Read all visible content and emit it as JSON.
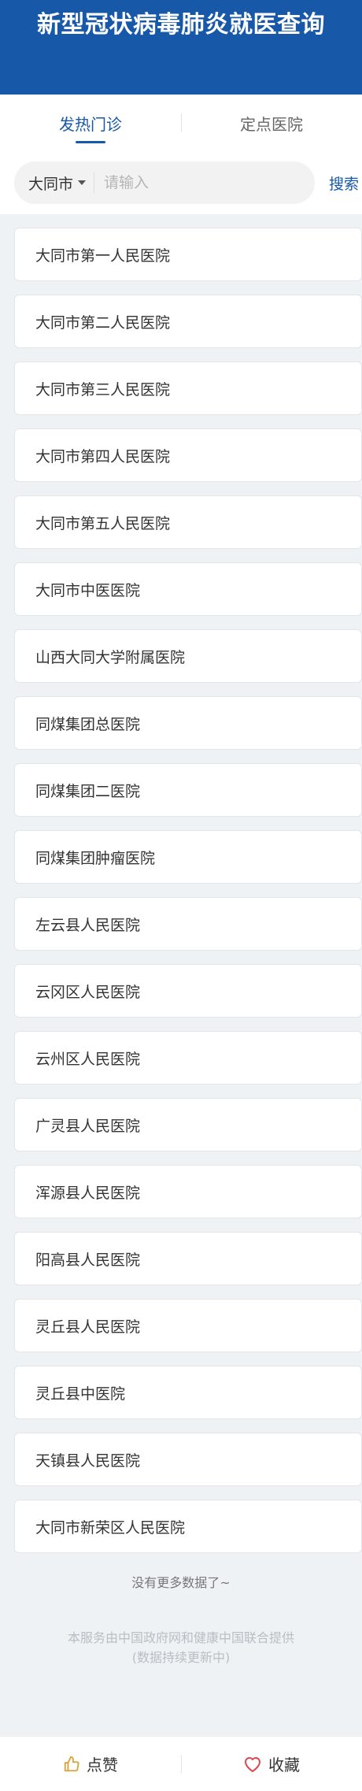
{
  "header": {
    "title": "新型冠状病毒肺炎就医查询"
  },
  "tabs": [
    {
      "label": "发热门诊",
      "active": true
    },
    {
      "label": "定点医院",
      "active": false
    }
  ],
  "search": {
    "city": "大同市",
    "placeholder": "请输入",
    "button_label": "搜索"
  },
  "hospitals": [
    "大同市第一人民医院",
    "大同市第二人民医院",
    "大同市第三人民医院",
    "大同市第四人民医院",
    "大同市第五人民医院",
    "大同市中医医院",
    "山西大同大学附属医院",
    "同煤集团总医院",
    "同煤集团二医院",
    "同煤集团肿瘤医院",
    "左云县人民医院",
    "云冈区人民医院",
    "云州区人民医院",
    "广灵县人民医院",
    "浑源县人民医院",
    "阳高县人民医院",
    "灵丘县人民医院",
    "灵丘县中医院",
    "天镇县人民医院",
    "大同市新荣区人民医院"
  ],
  "no_more": "没有更多数据了~",
  "footer": {
    "line1": "本服务由中国政府网和健康中国联合提供",
    "line2": "(数据持续更新中)"
  },
  "bottom_bar": {
    "like_label": "点赞",
    "favorite_label": "收藏"
  },
  "colors": {
    "brand": "#1758a8",
    "like_icon": "#d9a33a",
    "favorite_icon": "#e0454d"
  },
  "icons": {
    "like": "thumbs-up-icon",
    "favorite": "heart-icon",
    "city_dropdown": "caret-down-icon"
  }
}
